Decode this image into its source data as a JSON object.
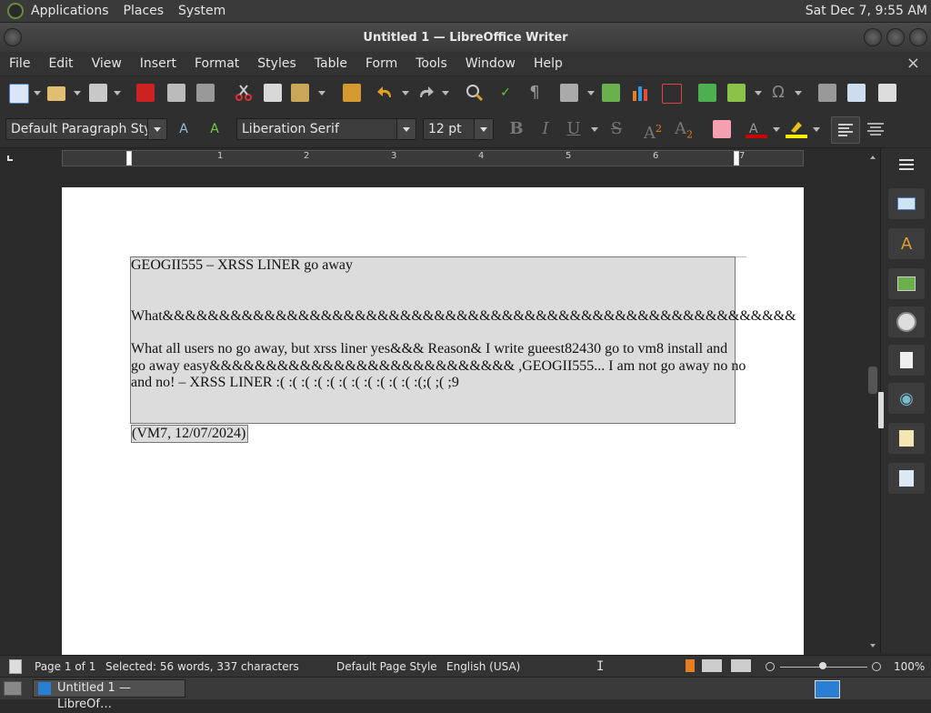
{
  "top_panel": {
    "menus": [
      "Applications",
      "Places",
      "System"
    ],
    "clock": "Sat Dec  7,  9:55 AM"
  },
  "window": {
    "title": "Untitled 1 — LibreOffice Writer"
  },
  "menubar": {
    "items": [
      "File",
      "Edit",
      "View",
      "Insert",
      "Format",
      "Styles",
      "Table",
      "Form",
      "Tools",
      "Window",
      "Help"
    ],
    "close_label": "×"
  },
  "formatting": {
    "paragraph_style": "Default Paragraph Style",
    "font_name": "Liberation Serif",
    "font_size": "12 pt",
    "bold_label": "B",
    "italic_label": "I",
    "underline_label": "U",
    "strike_label": "S",
    "superscript_label": "A",
    "subscript_label": "A",
    "sup_digit": "2",
    "sub_digit": "2"
  },
  "ruler": {
    "numbers": [
      "1",
      "2",
      "3",
      "4",
      "5",
      "6",
      "7"
    ]
  },
  "document": {
    "line1": "GEOGII555 – XRSS LINER go away",
    "line2": "What&&&&&&&&&&&&&&&&&&&&&&&&&&&&&&&&&&&&&&&&&&&&&&&&&&&&&&&&",
    "para3_line1": "What all users no go away, but xrss liner yes&&& Reason& I write gueest82430 go to vm8 install and",
    "para3_line2": "go away easy&&&&&&&&&&&&&&&&&&&&&&&&&&& ,GEOGII555... I am not go away no no",
    "para3_line3": "and no! – XRSS LINER :( :( :( :( :( :( :( :( :( :( :( :(;( ;( ;9",
    "signature": "(VM7, 12/07/2024)"
  },
  "statusbar": {
    "page": "Page 1 of 1",
    "selection": "Selected: 56 words, 337 characters",
    "page_style": "Default Page Style",
    "language": "English (USA)",
    "zoom": "100%"
  },
  "taskbar": {
    "task_label": "Untitled 1 — LibreOf…"
  },
  "colors": {
    "accent_red": "#cc0000",
    "highlight_yellow": "#ffee00"
  }
}
